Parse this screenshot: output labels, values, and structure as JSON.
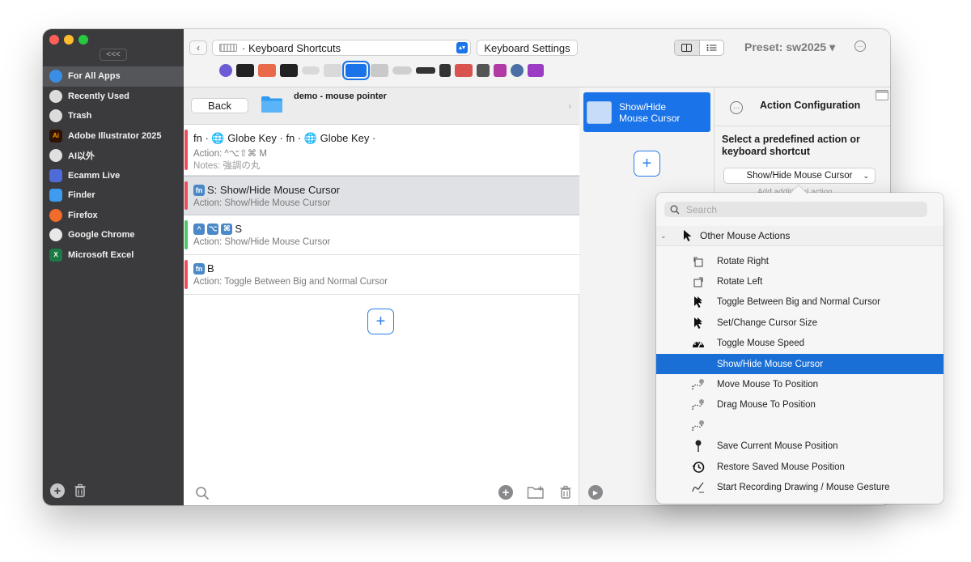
{
  "sidebar": {
    "collapse_label": "<<<",
    "apps": [
      {
        "label": "For All Apps",
        "selected": true,
        "icon": "globe-icon",
        "color": "#3a8ee6"
      },
      {
        "label": "Recently Used",
        "selected": false,
        "icon": "clock-icon",
        "color": "#dcdcdc"
      },
      {
        "label": "Trash",
        "selected": false,
        "icon": "trash-icon",
        "color": "#dcdcdc"
      },
      {
        "label": "Adobe Illustrator 2025",
        "selected": false,
        "icon": "illustrator-icon",
        "color": "#2e1205"
      },
      {
        "label": "AI以外",
        "selected": false,
        "icon": "circle-icon",
        "color": "#e0e0e0"
      },
      {
        "label": "Ecamm Live",
        "selected": false,
        "icon": "ecamm-icon",
        "color": "#4f6bd8"
      },
      {
        "label": "Finder",
        "selected": false,
        "icon": "finder-icon",
        "color": "#3d9bf0"
      },
      {
        "label": "Firefox",
        "selected": false,
        "icon": "firefox-icon",
        "color": "#f26b2a"
      },
      {
        "label": "Google Chrome",
        "selected": false,
        "icon": "chrome-icon",
        "color": "#e8e8e8"
      },
      {
        "label": "Microsoft Excel",
        "selected": false,
        "icon": "excel-icon",
        "color": "#1d7a45"
      }
    ]
  },
  "toolbar": {
    "group_select": "· Keyboard Shortcuts",
    "settings_button": "Keyboard Settings",
    "preset_label": "Preset: sw2025 ▾",
    "devices": [
      {
        "name": "touchbar-device-icon",
        "color": "#6b5bd6"
      },
      {
        "name": "stream-deck-device-icon",
        "color": "#222222"
      },
      {
        "name": "cute-device-icon",
        "color": "#e86a4a"
      },
      {
        "name": "pad-device-icon",
        "color": "#222222"
      },
      {
        "name": "magic-mouse-device-icon",
        "color": "#d9d9d9"
      },
      {
        "name": "trackpad-device-icon",
        "color": "#d9d9d9"
      },
      {
        "name": "keyboard-device-icon",
        "color": "#1a73e8"
      },
      {
        "name": "keys-device-icon",
        "color": "#c9c9c9"
      },
      {
        "name": "mouse-device-icon",
        "color": "#cfcfcf"
      },
      {
        "name": "apple-remote-device-icon",
        "color": "#333333"
      },
      {
        "name": "other-device-icon",
        "color": "#333333"
      },
      {
        "name": "midi-device-icon",
        "color": "#d9534f"
      },
      {
        "name": "controller-device-icon",
        "color": "#555555"
      },
      {
        "name": "drawing-device-icon",
        "color": "#b23aa5"
      },
      {
        "name": "automation-device-icon",
        "color": "#4a6fa5"
      },
      {
        "name": "purple-device-icon",
        "color": "#9c3cc4"
      }
    ]
  },
  "list": {
    "back_label": "Back",
    "folder_title": "demo - mouse pointer",
    "rows": [
      {
        "title": "fn · 🌐 Globe Key · fn · 🌐 Globe Key ·",
        "action": "Action: ^⌥⇧⌘ M",
        "notes": "Notes: 強調の丸",
        "bar_color": "#e8505b",
        "selected": false
      },
      {
        "title": "S: Show/Hide Mouse Cursor",
        "keys": [
          "fn"
        ],
        "action": "Action: Show/Hide Mouse Cursor",
        "bar_color": "#e8505b",
        "selected": true
      },
      {
        "title": "S",
        "keys": [
          "^",
          "⌥",
          "⌘"
        ],
        "action": "Action: Show/Hide Mouse Cursor",
        "bar_color": "#4cc76a",
        "selected": false
      },
      {
        "title": "B",
        "keys": [
          "fn"
        ],
        "action": "Action: Toggle Between Big and Normal Cursor",
        "bar_color": "#e8505b",
        "selected": false
      }
    ],
    "add_label": "+"
  },
  "action_panel": {
    "tile_label": "Show/Hide Mouse Cursor",
    "add_label": "+"
  },
  "config": {
    "title": "Action Configuration",
    "label": "Select a predefined action or keyboard shortcut",
    "selected_action": "Show/Hide Mouse Cursor",
    "hint": "Add additional action"
  },
  "popup": {
    "search_placeholder": "Search",
    "group_label": "Other Mouse Actions",
    "items": [
      {
        "label": "Rotate Right",
        "icon": "rotate-right-icon",
        "highlight": false
      },
      {
        "label": "Rotate Left",
        "icon": "rotate-left-icon",
        "highlight": false
      },
      {
        "label": "Toggle Between Big and Normal Cursor",
        "icon": "cursor-icon",
        "highlight": false
      },
      {
        "label": "Set/Change Cursor Size",
        "icon": "cursor-icon",
        "highlight": false
      },
      {
        "label": "Toggle Mouse Speed",
        "icon": "speedometer-icon",
        "highlight": false
      },
      {
        "label": "Show/Hide Mouse Cursor",
        "icon": "",
        "highlight": true
      },
      {
        "label": "Move Mouse To Position",
        "icon": "dotted-path-icon",
        "highlight": false
      },
      {
        "label": "Drag Mouse To Position",
        "icon": "dotted-path-icon",
        "highlight": false
      },
      {
        "label": "",
        "icon": "dotted-path-icon",
        "highlight": false
      },
      {
        "label": "Save Current Mouse Position",
        "icon": "pin-icon",
        "highlight": false
      },
      {
        "label": "Restore Saved Mouse Position",
        "icon": "history-icon",
        "highlight": false
      },
      {
        "label": "Start Recording Drawing / Mouse Gesture",
        "icon": "gesture-icon",
        "highlight": false
      }
    ]
  }
}
